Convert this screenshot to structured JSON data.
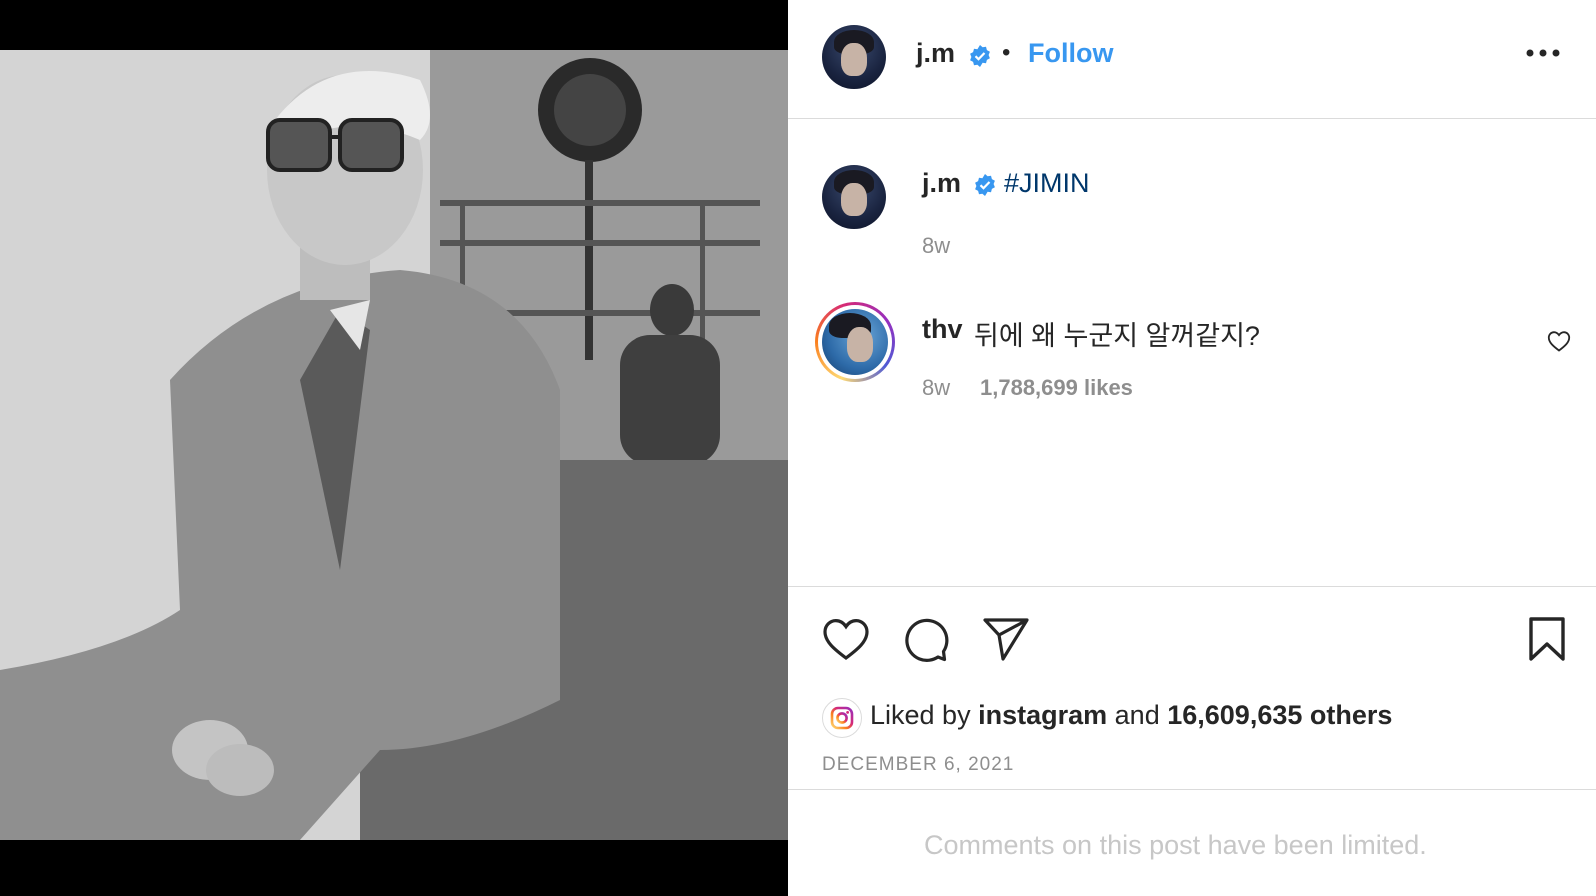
{
  "post": {
    "author": "j.m",
    "follow_label": "Follow",
    "separator": "•",
    "caption_author": "j.m",
    "caption": "#JIMIN",
    "caption_age": "8w",
    "comment": {
      "author": "thv",
      "text": "뒤에 왜 누군지 알꺼같지?",
      "age": "8w",
      "likes": "1,788,699 likes"
    },
    "liked_by_prefix": "Liked by",
    "liked_by_user": "instagram",
    "liked_by_and": "and",
    "liked_by_others": "16,609,635 others",
    "date": "DECEMBER 6, 2021",
    "comments_limited": "Comments on this post have been limited."
  },
  "colors": {
    "link_blue": "#3897f0",
    "hashtag": "#00376b",
    "verified": "#3897f0",
    "muted": "#8e8e8e"
  },
  "icons": {
    "more": "more-options-icon",
    "like": "heart-icon",
    "comment": "comment-icon",
    "share": "paper-plane-icon",
    "save": "bookmark-icon",
    "comment_like": "small-heart-icon",
    "verified": "verified-badge-icon",
    "instagram_avatar": "instagram-logo-icon"
  }
}
